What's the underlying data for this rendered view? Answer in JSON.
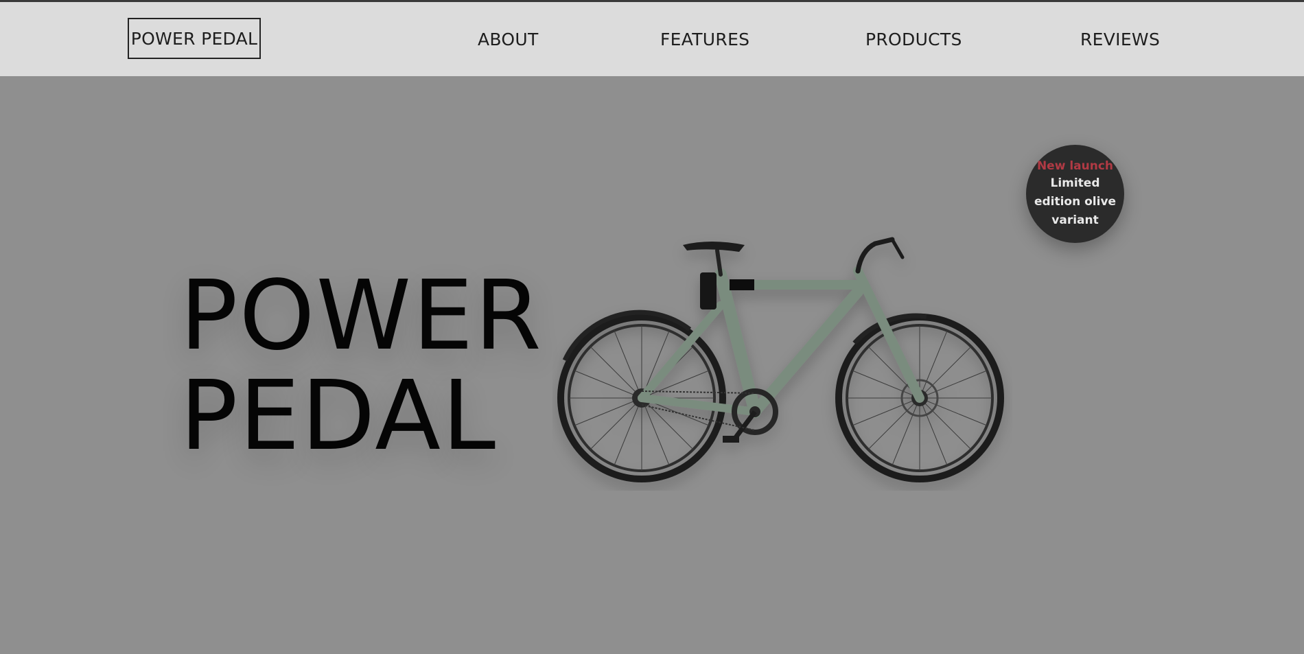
{
  "nav": {
    "brand": "POWER PEDAL",
    "links": [
      "ABOUT",
      "FEATURES",
      "PRODUCTS",
      "REVIEWS"
    ]
  },
  "hero": {
    "title_line1": "POWER",
    "title_line2": "PEDAL",
    "image_name": "olive-electric-bike"
  },
  "badge": {
    "title": "New launch",
    "line1": "Limited",
    "line2": "edition olive",
    "line3": "variant"
  },
  "colors": {
    "navbar_bg": "#dcdcdc",
    "hero_bg": "#8f8f8f",
    "badge_bg": "#2b2b2b",
    "badge_accent": "#b13a44",
    "bike_frame": "#7a8c7e"
  }
}
